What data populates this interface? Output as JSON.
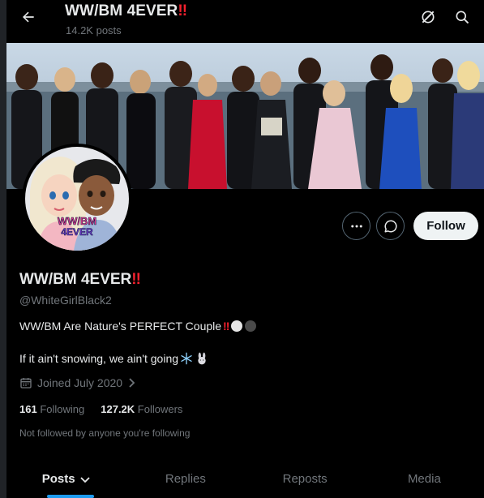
{
  "header": {
    "title": "WW/BM 4EVER",
    "title_suffix": "!!",
    "post_count": "14.2K posts"
  },
  "profile": {
    "display_name": "WW/BM 4EVER",
    "name_suffix": "!!",
    "handle": "@WhiteGirlBlack2",
    "avatar_logo_line1": "WW/BM",
    "avatar_logo_line2": "4EVER",
    "bio_line1": "WW/BM Are Nature's PERFECT Couple",
    "bio_line1_suffix": "!!",
    "bio_line2": "If it ain't snowing, we ain't going",
    "joined": "Joined July 2020",
    "following_count": "161",
    "following_label": "Following",
    "followers_count": "127.2K",
    "followers_label": "Followers",
    "not_followed": "Not followed by anyone you're following"
  },
  "actions": {
    "follow_label": "Follow"
  },
  "tabs": [
    {
      "label": "Posts"
    },
    {
      "label": "Replies"
    },
    {
      "label": "Reposts"
    },
    {
      "label": "Media"
    }
  ],
  "colors": {
    "accent": "#1d9bf0",
    "alert_red": "#f4212e",
    "text_primary": "#e7e9ea",
    "text_secondary": "#71767b",
    "background": "#000000"
  },
  "icons": {
    "back": "arrow-left-icon",
    "grok": "grok-icon",
    "search": "search-icon",
    "more": "more-icon",
    "message": "message-icon",
    "calendar": "calendar-icon",
    "chevron_right": "chevron-right-icon",
    "chevron_down": "chevron-down-icon"
  }
}
